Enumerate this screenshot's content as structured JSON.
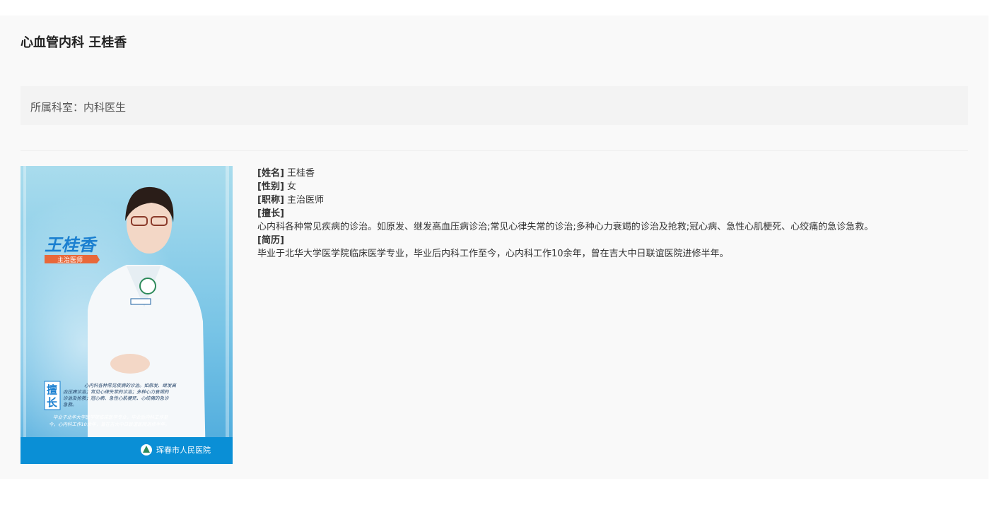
{
  "page": {
    "title": "心血管内科 王桂香",
    "department_label": "所属科室：",
    "department_value": "内科医生"
  },
  "doctor": {
    "name_label": "[姓名]",
    "name": "王桂香",
    "gender_label": "[性别]",
    "gender": "女",
    "title_label": "[职称]",
    "title": "主治医师",
    "specialty_label": "[擅长]",
    "specialty": "心内科各种常见疾病的诊治。如原发、继发高血压病诊治;常见心律失常的诊治;多种心力衰竭的诊治及抢救;冠心病、急性心肌梗死、心绞痛的急诊急救。",
    "resume_label": "[简历]",
    "resume": "毕业于北华大学医学院临床医学专业，毕业后内科工作至今，心内科工作10余年，曾在吉大中日联谊医院进修半年。"
  },
  "poster": {
    "name": "王桂香",
    "title": "主治医师",
    "badge_char1": "擅",
    "badge_char2": "长",
    "specialty_line1": "心内科各种常见疾病的诊治。如原发、继发高",
    "specialty_line2": "血压病诊治；常见心律失常的诊治；多种心力衰竭的",
    "specialty_line3": "诊治及抢救；冠心病、急性心肌梗死、心绞痛的急诊",
    "specialty_line4": "急救。",
    "resume_line1": "毕业于北华大学医学院临床医学专业，毕业后内科工作至",
    "resume_line2": "今，心内科工作10余年，曾在吉大中日联谊医院进修半年。",
    "hospital": "珲春市人民医院"
  },
  "colors": {
    "poster_top": "#8fd0e8",
    "poster_bottom": "#3aa0d8",
    "poster_footer": "#0a8fd6",
    "name_blue": "#1a7fd0",
    "ribbon": "#e8683a"
  }
}
